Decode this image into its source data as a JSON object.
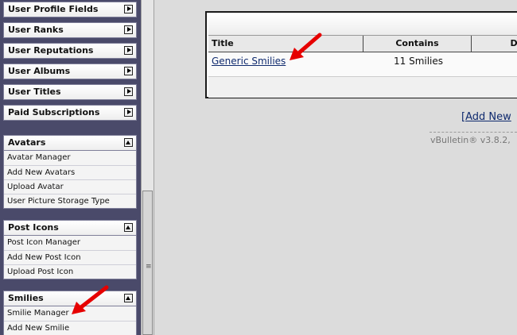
{
  "sidebar": {
    "collapsed_categories": [
      {
        "label": "User Profile Fields"
      },
      {
        "label": "User Ranks"
      },
      {
        "label": "User Reputations"
      },
      {
        "label": "User Albums"
      },
      {
        "label": "User Titles"
      },
      {
        "label": "Paid Subscriptions"
      }
    ],
    "avatars": {
      "label": "Avatars",
      "items": [
        "Avatar Manager",
        "Add New Avatars",
        "Upload Avatar",
        "User Picture Storage Type"
      ]
    },
    "post_icons": {
      "label": "Post Icons",
      "items": [
        "Post Icon Manager",
        "Add New Post Icon",
        "Upload Post Icon"
      ]
    },
    "smilies": {
      "label": "Smilies",
      "items": [
        "Smilie Manager",
        "Add New Smilie"
      ]
    }
  },
  "table": {
    "columns": [
      "Title",
      "Contains",
      "Dis"
    ],
    "rows": [
      {
        "title": "Generic Smilies",
        "contains": "11 Smilies"
      }
    ]
  },
  "main": {
    "add_new_label": "[Add New",
    "footer": "vBulletin® v3.8.2,"
  },
  "colors": {
    "sidebar_bg": "#4a4a6a",
    "link": "#0f2a6e",
    "annotation_arrow": "#e60000"
  }
}
